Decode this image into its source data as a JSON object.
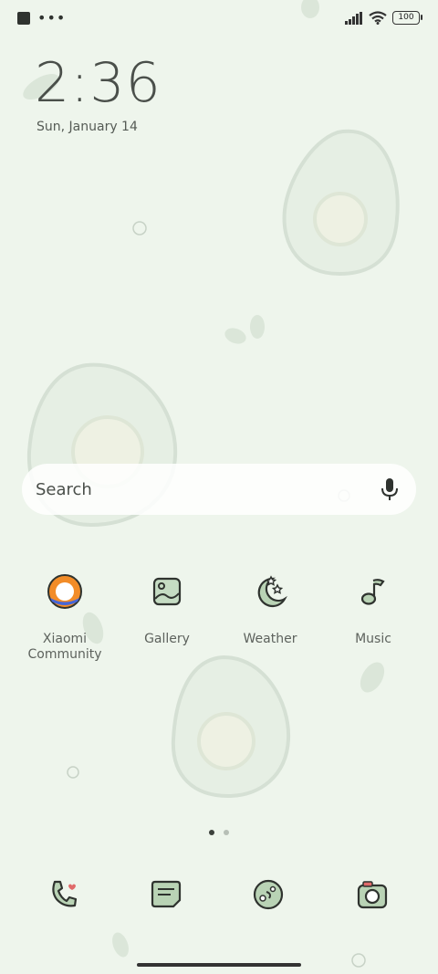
{
  "status_bar": {
    "battery": "100"
  },
  "lock": {
    "time": "2:36",
    "date": "Sun, January 14"
  },
  "search": {
    "placeholder": "Search"
  },
  "apps": [
    {
      "label": "Xiaomi Community",
      "icon": "xiaomi-community-icon"
    },
    {
      "label": "Gallery",
      "icon": "gallery-icon"
    },
    {
      "label": "Weather",
      "icon": "weather-icon"
    },
    {
      "label": "Music",
      "icon": "music-icon"
    }
  ],
  "dock": [
    {
      "icon": "phone-icon"
    },
    {
      "icon": "messages-icon"
    },
    {
      "icon": "browser-icon"
    },
    {
      "icon": "camera-icon"
    }
  ],
  "page_indicator": {
    "pages": 2,
    "current": 1
  },
  "colors": {
    "background": "#eef5ec",
    "icon_green": "#9bb99a",
    "dark_line": "#2f332f"
  }
}
